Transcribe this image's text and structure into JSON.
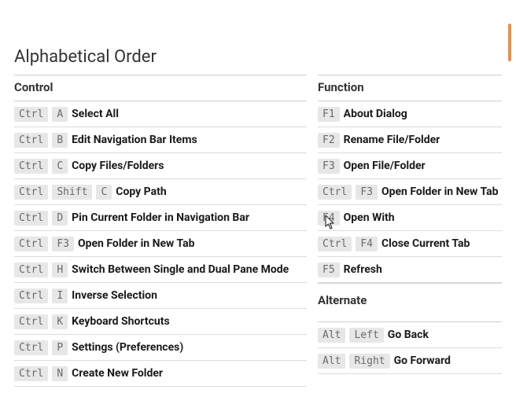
{
  "title": "Alphabetical Order",
  "columns": {
    "left_header": "Control",
    "right_header": "Function",
    "right_subheader": "Alternate"
  },
  "left": [
    {
      "keys": [
        "Ctrl",
        "A"
      ],
      "label": "Select All"
    },
    {
      "keys": [
        "Ctrl",
        "B"
      ],
      "label": "Edit Navigation Bar Items"
    },
    {
      "keys": [
        "Ctrl",
        "C"
      ],
      "label": "Copy Files/Folders"
    },
    {
      "keys": [
        "Ctrl",
        "Shift",
        "C"
      ],
      "label": "Copy Path"
    },
    {
      "keys": [
        "Ctrl",
        "D"
      ],
      "label": "Pin Current Folder in Navigation Bar"
    },
    {
      "keys": [
        "Ctrl",
        "F3"
      ],
      "label": "Open Folder in New Tab"
    },
    {
      "keys": [
        "Ctrl",
        "H"
      ],
      "label": "Switch Between Single and Dual Pane Mode"
    },
    {
      "keys": [
        "Ctrl",
        "I"
      ],
      "label": "Inverse Selection"
    },
    {
      "keys": [
        "Ctrl",
        "K"
      ],
      "label": "Keyboard Shortcuts"
    },
    {
      "keys": [
        "Ctrl",
        "P"
      ],
      "label": "Settings (Preferences)"
    },
    {
      "keys": [
        "Ctrl",
        "N"
      ],
      "label": "Create New Folder"
    }
  ],
  "right_top": [
    {
      "keys": [
        "F1"
      ],
      "label": "About Dialog"
    },
    {
      "keys": [
        "F2"
      ],
      "label": "Rename File/Folder"
    },
    {
      "keys": [
        "F3"
      ],
      "label": "Open File/Folder"
    },
    {
      "keys": [
        "Ctrl",
        "F3"
      ],
      "label": "Open Folder in New Tab"
    },
    {
      "keys": [
        "F4"
      ],
      "label": "Open With"
    },
    {
      "keys": [
        "Ctrl",
        "F4"
      ],
      "label": "Close Current Tab"
    },
    {
      "keys": [
        "F5"
      ],
      "label": "Refresh"
    }
  ],
  "right_alt": [
    {
      "keys": [
        "Alt",
        "Left"
      ],
      "label": "Go Back"
    },
    {
      "keys": [
        "Alt",
        "Right"
      ],
      "label": "Go Forward"
    }
  ]
}
